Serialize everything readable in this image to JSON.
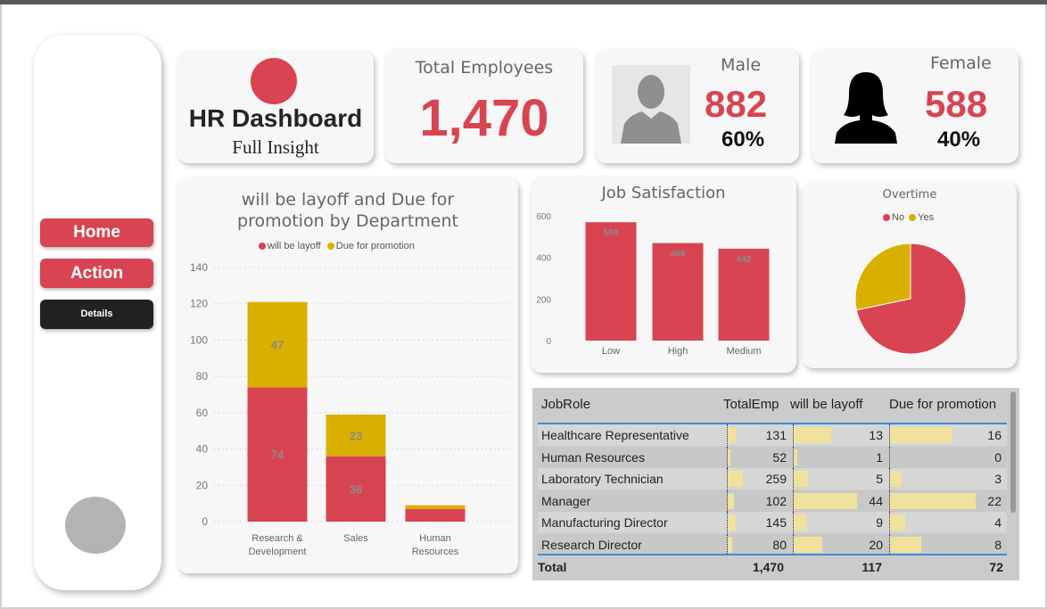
{
  "title_card": {
    "title": "HR Dashboard",
    "subtitle": "Full Insight"
  },
  "sidebar": {
    "items": [
      {
        "label": "Home"
      },
      {
        "label": "Action"
      },
      {
        "label": "Details"
      }
    ]
  },
  "kpi": {
    "total_label": "Total Employees",
    "total_value": "1,470",
    "male_label": "Male",
    "male_value": "882",
    "male_pct": "60%",
    "female_label": "Female",
    "female_value": "588",
    "female_pct": "40%"
  },
  "colors": {
    "accent": "#d94452",
    "secondary": "#d9b000",
    "dark": "#222222"
  },
  "chart_data": [
    {
      "type": "bar",
      "stacked": true,
      "title": "will be layoff and Due for promotion by Department",
      "categories": [
        "Research & Development",
        "Sales",
        "Human Resources"
      ],
      "category_lines": [
        [
          "Research &",
          "Development"
        ],
        [
          "Sales"
        ],
        [
          "Human",
          "Resources"
        ]
      ],
      "series": [
        {
          "name": "will be layoff",
          "values": [
            74,
            36,
            7
          ],
          "color": "#d94452",
          "labels": [
            "74",
            "36",
            ""
          ]
        },
        {
          "name": "Due for promotion",
          "values": [
            47,
            23,
            2
          ],
          "color": "#d9b000",
          "labels": [
            "47",
            "23",
            ""
          ]
        }
      ],
      "yticks": [
        "140",
        "120",
        "100",
        "80",
        "60",
        "40",
        "20",
        "0"
      ],
      "ylim": [
        0,
        140
      ],
      "grid": true,
      "legend": "top"
    },
    {
      "type": "bar",
      "title": "Job Satisfaction",
      "categories": [
        "Low",
        "High",
        "Medium"
      ],
      "values": [
        569,
        469,
        442
      ],
      "labels": [
        "569",
        "469",
        "442"
      ],
      "color": "#d94452",
      "yticks": [
        "600",
        "400",
        "200",
        "0"
      ],
      "ylim": [
        0,
        600
      ]
    },
    {
      "type": "pie",
      "title": "Overtime",
      "series": [
        {
          "name": "No",
          "value": 1054,
          "color": "#d94452"
        },
        {
          "name": "Yes",
          "value": 416,
          "color": "#d9b000"
        }
      ],
      "legend": "top"
    },
    {
      "type": "table",
      "columns": [
        "JobRole",
        "TotalEmp",
        "will be layoff",
        "Due for promotion"
      ],
      "rows": [
        {
          "role": "Healthcare Representative",
          "total": "131",
          "layoff": "13",
          "promotion": "16",
          "bars": [
            0.23,
            0.59,
            0.73
          ]
        },
        {
          "role": "Human Resources",
          "total": "52",
          "layoff": "1",
          "promotion": "0",
          "bars": [
            0.09,
            0.05,
            0.0
          ]
        },
        {
          "role": "Laboratory Technician",
          "total": "259",
          "layoff": "5",
          "promotion": "3",
          "bars": [
            0.45,
            0.23,
            0.14
          ]
        },
        {
          "role": "Manager",
          "total": "102",
          "layoff": "44",
          "promotion": "22",
          "bars": [
            0.18,
            1.0,
            1.0
          ]
        },
        {
          "role": "Manufacturing Director",
          "total": "145",
          "layoff": "9",
          "promotion": "4",
          "bars": [
            0.25,
            0.2,
            0.18
          ]
        },
        {
          "role": "Research Director",
          "total": "80",
          "layoff": "20",
          "promotion": "8",
          "bars": [
            0.14,
            0.45,
            0.36
          ]
        }
      ],
      "total": {
        "label": "Total",
        "total": "1,470",
        "layoff": "117",
        "promotion": "72"
      }
    }
  ]
}
